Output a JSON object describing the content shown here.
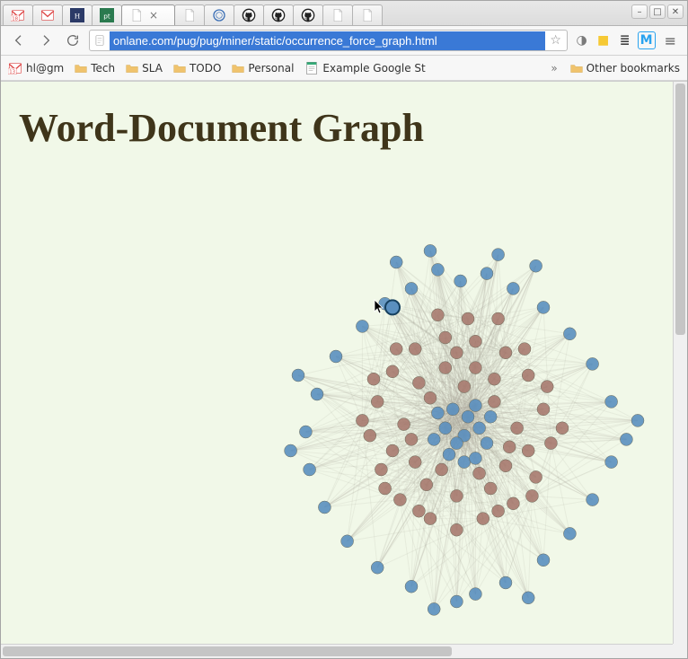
{
  "tabs": [
    {
      "icon": "gmail",
      "badge": "18"
    },
    {
      "icon": "gmail"
    },
    {
      "icon": "hi"
    },
    {
      "icon": "pt"
    },
    {
      "icon": "blank",
      "active": true
    },
    {
      "icon": "blank"
    },
    {
      "icon": "spiral"
    },
    {
      "icon": "github"
    },
    {
      "icon": "github"
    },
    {
      "icon": "github"
    },
    {
      "icon": "blank"
    },
    {
      "icon": "blank"
    }
  ],
  "window_buttons": {
    "minimize": "–",
    "maximize": "□",
    "close": "✕"
  },
  "toolbar": {
    "url": "onlane.com/pug/pug/miner/static/occurrence_force_graph.html"
  },
  "extensions": [
    {
      "name": "ghostery",
      "glyph": "◑",
      "color": "#7a7a7a"
    },
    {
      "name": "notes",
      "glyph": "■",
      "color": "#f6c934"
    },
    {
      "name": "buffer",
      "glyph": "≣",
      "color": "#444"
    },
    {
      "name": "mail",
      "glyph": "M",
      "color": "#29a3ef"
    }
  ],
  "bookmarks_bar": {
    "items": [
      {
        "type": "icon",
        "label": "hl@gm",
        "icon": "gmail",
        "badge": "13"
      },
      {
        "type": "folder",
        "label": "Tech"
      },
      {
        "type": "folder",
        "label": "SLA"
      },
      {
        "type": "folder",
        "label": "TODO"
      },
      {
        "type": "folder",
        "label": "Personal"
      },
      {
        "type": "page",
        "label": "Example Google St",
        "icon": "doc"
      }
    ],
    "overflow_glyph": "»",
    "other": {
      "label": "Other bookmarks"
    }
  },
  "page": {
    "title": "Word-Document Graph"
  },
  "chart_data": {
    "type": "force-directed-graph",
    "title": "Word-Document Graph",
    "node_groups": [
      {
        "name": "blue",
        "color": "#5a8fbf",
        "approx_count": 60
      },
      {
        "name": "brown",
        "color": "#a77a6f",
        "approx_count": 55
      }
    ],
    "nodes": [
      {
        "id": 0,
        "g": "blue",
        "x": 0.48,
        "y": 0.1
      },
      {
        "id": 1,
        "g": "blue",
        "x": 0.42,
        "y": 0.07
      },
      {
        "id": 2,
        "g": "blue",
        "x": 0.55,
        "y": 0.08
      },
      {
        "id": 3,
        "g": "blue",
        "x": 0.35,
        "y": 0.12
      },
      {
        "id": 4,
        "g": "blue",
        "x": 0.62,
        "y": 0.12
      },
      {
        "id": 5,
        "g": "blue",
        "x": 0.28,
        "y": 0.16
      },
      {
        "id": 6,
        "g": "blue",
        "x": 0.7,
        "y": 0.17
      },
      {
        "id": 7,
        "g": "blue",
        "x": 0.22,
        "y": 0.22
      },
      {
        "id": 8,
        "g": "blue",
        "x": 0.77,
        "y": 0.24
      },
      {
        "id": 9,
        "g": "blue",
        "x": 0.15,
        "y": 0.3
      },
      {
        "id": 10,
        "g": "blue",
        "x": 0.83,
        "y": 0.32
      },
      {
        "id": 11,
        "g": "blue",
        "x": 0.1,
        "y": 0.4
      },
      {
        "id": 12,
        "g": "blue",
        "x": 0.88,
        "y": 0.42
      },
      {
        "id": 13,
        "g": "blue",
        "x": 0.07,
        "y": 0.5
      },
      {
        "id": 14,
        "g": "blue",
        "x": 0.95,
        "y": 0.47
      },
      {
        "id": 15,
        "g": "blue",
        "x": 0.08,
        "y": 0.6
      },
      {
        "id": 16,
        "g": "blue",
        "x": 0.88,
        "y": 0.58
      },
      {
        "id": 17,
        "g": "blue",
        "x": 0.12,
        "y": 0.7
      },
      {
        "id": 18,
        "g": "blue",
        "x": 0.83,
        "y": 0.68
      },
      {
        "id": 19,
        "g": "blue",
        "x": 0.18,
        "y": 0.79
      },
      {
        "id": 20,
        "g": "blue",
        "x": 0.77,
        "y": 0.77
      },
      {
        "id": 21,
        "g": "blue",
        "x": 0.26,
        "y": 0.86
      },
      {
        "id": 22,
        "g": "blue",
        "x": 0.7,
        "y": 0.84
      },
      {
        "id": 23,
        "g": "blue",
        "x": 0.35,
        "y": 0.91
      },
      {
        "id": 24,
        "g": "blue",
        "x": 0.6,
        "y": 0.9
      },
      {
        "id": 25,
        "g": "blue",
        "x": 0.47,
        "y": 0.95
      },
      {
        "id": 26,
        "g": "blue",
        "x": 0.52,
        "y": 0.93
      },
      {
        "id": 27,
        "g": "blue",
        "x": 0.4,
        "y": 0.02
      },
      {
        "id": 28,
        "g": "blue",
        "x": 0.58,
        "y": 0.03
      },
      {
        "id": 29,
        "g": "blue",
        "x": 0.03,
        "y": 0.55
      },
      {
        "id": 30,
        "g": "blue",
        "x": 0.41,
        "y": 0.97
      },
      {
        "id": 31,
        "g": "blue",
        "x": 0.66,
        "y": 0.94
      },
      {
        "id": 32,
        "g": "blue",
        "x": 0.05,
        "y": 0.35
      },
      {
        "id": 33,
        "g": "blue",
        "x": 0.92,
        "y": 0.52
      },
      {
        "id": 34,
        "g": "blue",
        "x": 0.31,
        "y": 0.05
      },
      {
        "id": 35,
        "g": "blue",
        "x": 0.68,
        "y": 0.06
      },
      {
        "id": 36,
        "g": "blue",
        "x": 0.46,
        "y": 0.44
      },
      {
        "id": 37,
        "g": "blue",
        "x": 0.5,
        "y": 0.46
      },
      {
        "id": 38,
        "g": "blue",
        "x": 0.44,
        "y": 0.49
      },
      {
        "id": 39,
        "g": "blue",
        "x": 0.49,
        "y": 0.51
      },
      {
        "id": 40,
        "g": "blue",
        "x": 0.52,
        "y": 0.43
      },
      {
        "id": 41,
        "g": "blue",
        "x": 0.47,
        "y": 0.53
      },
      {
        "id": 42,
        "g": "blue",
        "x": 0.53,
        "y": 0.49
      },
      {
        "id": 43,
        "g": "blue",
        "x": 0.42,
        "y": 0.45
      },
      {
        "id": 44,
        "g": "blue",
        "x": 0.45,
        "y": 0.56
      },
      {
        "id": 45,
        "g": "blue",
        "x": 0.55,
        "y": 0.53
      },
      {
        "id": 46,
        "g": "blue",
        "x": 0.49,
        "y": 0.58
      },
      {
        "id": 47,
        "g": "blue",
        "x": 0.41,
        "y": 0.52
      },
      {
        "id": 48,
        "g": "blue",
        "x": 0.56,
        "y": 0.46
      },
      {
        "id": 49,
        "g": "blue",
        "x": 0.52,
        "y": 0.57
      },
      {
        "id": 50,
        "g": "blue",
        "x": 0.3,
        "y": 0.17,
        "highlight": true
      },
      {
        "id": 60,
        "g": "brown",
        "x": 0.36,
        "y": 0.28
      },
      {
        "id": 61,
        "g": "brown",
        "x": 0.44,
        "y": 0.25
      },
      {
        "id": 62,
        "g": "brown",
        "x": 0.52,
        "y": 0.26
      },
      {
        "id": 63,
        "g": "brown",
        "x": 0.6,
        "y": 0.29
      },
      {
        "id": 64,
        "g": "brown",
        "x": 0.3,
        "y": 0.34
      },
      {
        "id": 65,
        "g": "brown",
        "x": 0.66,
        "y": 0.35
      },
      {
        "id": 66,
        "g": "brown",
        "x": 0.26,
        "y": 0.42
      },
      {
        "id": 67,
        "g": "brown",
        "x": 0.7,
        "y": 0.44
      },
      {
        "id": 68,
        "g": "brown",
        "x": 0.24,
        "y": 0.51
      },
      {
        "id": 69,
        "g": "brown",
        "x": 0.72,
        "y": 0.53
      },
      {
        "id": 70,
        "g": "brown",
        "x": 0.27,
        "y": 0.6
      },
      {
        "id": 71,
        "g": "brown",
        "x": 0.68,
        "y": 0.62
      },
      {
        "id": 72,
        "g": "brown",
        "x": 0.32,
        "y": 0.68
      },
      {
        "id": 73,
        "g": "brown",
        "x": 0.62,
        "y": 0.69
      },
      {
        "id": 74,
        "g": "brown",
        "x": 0.4,
        "y": 0.73
      },
      {
        "id": 75,
        "g": "brown",
        "x": 0.54,
        "y": 0.73
      },
      {
        "id": 76,
        "g": "brown",
        "x": 0.47,
        "y": 0.76
      },
      {
        "id": 77,
        "g": "brown",
        "x": 0.37,
        "y": 0.37
      },
      {
        "id": 78,
        "g": "brown",
        "x": 0.57,
        "y": 0.36
      },
      {
        "id": 79,
        "g": "brown",
        "x": 0.33,
        "y": 0.48
      },
      {
        "id": 80,
        "g": "brown",
        "x": 0.63,
        "y": 0.49
      },
      {
        "id": 81,
        "g": "brown",
        "x": 0.36,
        "y": 0.58
      },
      {
        "id": 82,
        "g": "brown",
        "x": 0.6,
        "y": 0.59
      },
      {
        "id": 83,
        "g": "brown",
        "x": 0.44,
        "y": 0.33
      },
      {
        "id": 84,
        "g": "brown",
        "x": 0.52,
        "y": 0.33
      },
      {
        "id": 85,
        "g": "brown",
        "x": 0.3,
        "y": 0.55
      },
      {
        "id": 86,
        "g": "brown",
        "x": 0.66,
        "y": 0.55
      },
      {
        "id": 87,
        "g": "brown",
        "x": 0.39,
        "y": 0.64
      },
      {
        "id": 88,
        "g": "brown",
        "x": 0.56,
        "y": 0.65
      },
      {
        "id": 89,
        "g": "brown",
        "x": 0.47,
        "y": 0.67
      },
      {
        "id": 90,
        "g": "brown",
        "x": 0.4,
        "y": 0.41
      },
      {
        "id": 91,
        "g": "brown",
        "x": 0.57,
        "y": 0.42
      },
      {
        "id": 92,
        "g": "brown",
        "x": 0.35,
        "y": 0.52
      },
      {
        "id": 93,
        "g": "brown",
        "x": 0.61,
        "y": 0.54
      },
      {
        "id": 94,
        "g": "brown",
        "x": 0.43,
        "y": 0.6
      },
      {
        "id": 95,
        "g": "brown",
        "x": 0.53,
        "y": 0.61
      },
      {
        "id": 96,
        "g": "brown",
        "x": 0.49,
        "y": 0.38
      },
      {
        "id": 97,
        "g": "brown",
        "x": 0.31,
        "y": 0.28
      },
      {
        "id": 98,
        "g": "brown",
        "x": 0.65,
        "y": 0.28
      },
      {
        "id": 99,
        "g": "brown",
        "x": 0.47,
        "y": 0.29
      },
      {
        "id": 100,
        "g": "brown",
        "x": 0.25,
        "y": 0.36
      },
      {
        "id": 101,
        "g": "brown",
        "x": 0.71,
        "y": 0.38
      },
      {
        "id": 102,
        "g": "brown",
        "x": 0.22,
        "y": 0.47
      },
      {
        "id": 103,
        "g": "brown",
        "x": 0.75,
        "y": 0.49
      },
      {
        "id": 104,
        "g": "brown",
        "x": 0.28,
        "y": 0.65
      },
      {
        "id": 105,
        "g": "brown",
        "x": 0.67,
        "y": 0.67
      },
      {
        "id": 106,
        "g": "brown",
        "x": 0.37,
        "y": 0.71
      },
      {
        "id": 107,
        "g": "brown",
        "x": 0.58,
        "y": 0.71
      },
      {
        "id": 108,
        "g": "brown",
        "x": 0.5,
        "y": 0.2
      },
      {
        "id": 109,
        "g": "brown",
        "x": 0.42,
        "y": 0.19
      },
      {
        "id": 110,
        "g": "brown",
        "x": 0.58,
        "y": 0.2
      }
    ],
    "edges_style": {
      "stroke": "#aaa99a",
      "opacity": 0.35
    },
    "center_hubs": [
      36,
      37,
      38,
      39,
      40,
      41,
      42,
      43,
      44,
      45,
      46,
      47,
      48,
      49
    ],
    "note": "Dense force-directed co-occurrence graph; blue nodes ring the periphery and cluster at center, brown nodes occupy mid-ring. Every outer blue node links to several brown mid nodes and to the central blue hub cluster."
  },
  "colors": {
    "page_bg": "#f1f8e8",
    "heading": "#3f351a",
    "node_blue": "#5a8fbf",
    "node_brown": "#a77a6f",
    "edge": "#aaa99a"
  }
}
